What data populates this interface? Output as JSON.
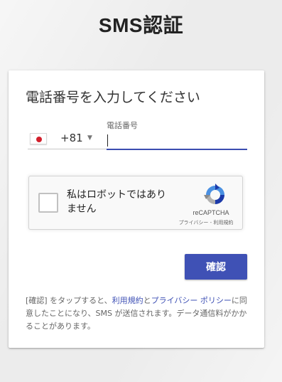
{
  "page": {
    "title": "SMS認証"
  },
  "card": {
    "heading": "電話番号を入力してください"
  },
  "country": {
    "flag": "japan-flag-icon",
    "dial_code": "+81",
    "caret": "▼"
  },
  "phone": {
    "label": "電話番号",
    "value": "",
    "placeholder": ""
  },
  "recaptcha": {
    "label": "私はロボットではありません",
    "checked": false,
    "brand": "reCAPTCHA",
    "privacy": "プライバシー",
    "separator": " - ",
    "terms": "利用規約"
  },
  "actions": {
    "confirm_label": "確認"
  },
  "legal": {
    "prefix": "[確認] をタップすると、",
    "terms_link": "利用規約",
    "and": "と",
    "privacy_link": "プライバシー ポリシー",
    "suffix": "に同意したことになり、SMS が送信されます。データ通信料がかかることがあります。"
  },
  "colors": {
    "accent": "#3f51b5",
    "background": "#ececec"
  }
}
